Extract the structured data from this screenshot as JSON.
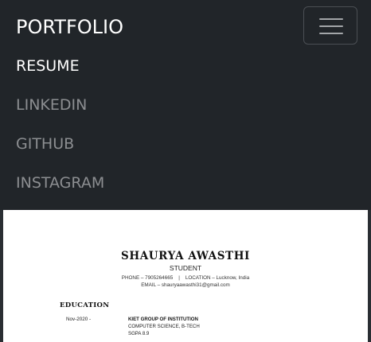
{
  "navbar": {
    "brand": "PORTFOLIO",
    "toggler_icon": "hamburger-menu-icon",
    "links": [
      {
        "label": "RESUME",
        "active": true
      },
      {
        "label": "LINKEDIN",
        "active": false
      },
      {
        "label": "GITHUB",
        "active": false
      },
      {
        "label": "INSTAGRAM",
        "active": false
      }
    ]
  },
  "resume": {
    "name": "SHAURYA AWASTHI",
    "subtitle": "STUDENT",
    "contact": "PHONE – 7905264665    |    LOCATION – Lucknow, India",
    "email": "EMAIL – shauryaawasthi31@gmail.com",
    "education": {
      "heading": "EDUCATION",
      "date": "Nov-2020 -",
      "institution": "KIET GROUP OF INSTITUTION",
      "degree": "COMPUTER SCIENCE, B-TECH",
      "sgpa": "SGPA 8.9"
    }
  },
  "colors": {
    "navbar_bg": "#212529",
    "link_active": "#ffffff",
    "link_inactive": "#8c8e91"
  }
}
